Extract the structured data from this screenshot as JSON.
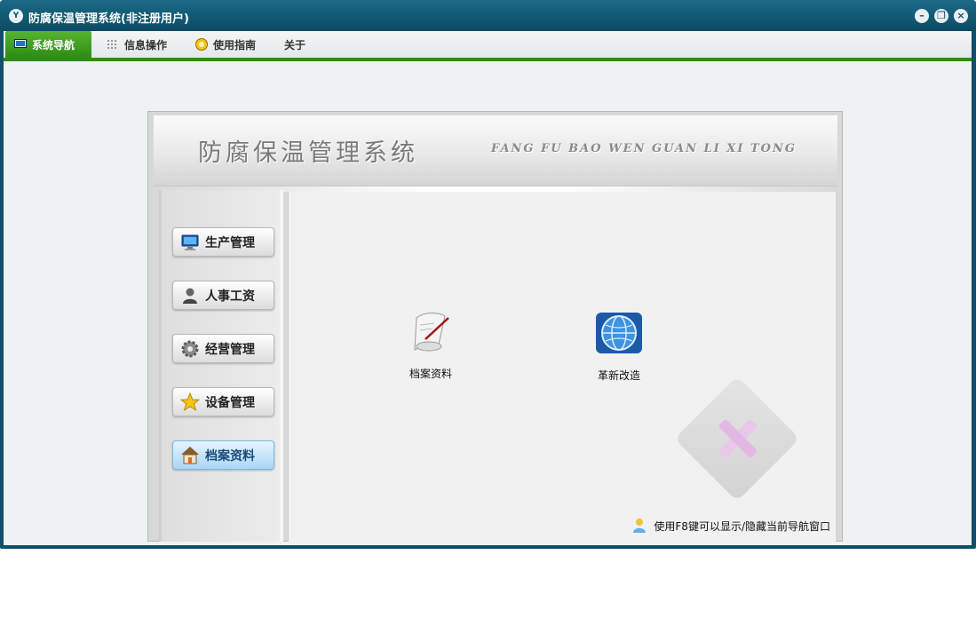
{
  "window": {
    "title": "防腐保温管理系统(非注册用户)",
    "app_icon_text": "Y"
  },
  "menubar": {
    "items": [
      {
        "label": "系统导航",
        "icon": "monitor-icon",
        "active": true
      },
      {
        "label": "信息操作",
        "icon": "grid-icon",
        "active": false
      },
      {
        "label": "使用指南",
        "icon": "help-icon",
        "active": false
      },
      {
        "label": "关于",
        "icon": "",
        "active": false
      }
    ]
  },
  "banner": {
    "title": "防腐保温管理系统",
    "subtitle": "FANG FU BAO  WEN  GUAN  LI  XI  TONG"
  },
  "sidebar": {
    "items": [
      {
        "label": "生产管理",
        "icon": "computer-icon",
        "active": false
      },
      {
        "label": "人事工资",
        "icon": "person-icon",
        "active": false
      },
      {
        "label": "经营管理",
        "icon": "gear-icon",
        "active": false
      },
      {
        "label": "设备管理",
        "icon": "star-icon",
        "active": false
      },
      {
        "label": "档案资料",
        "icon": "house-icon",
        "active": true
      }
    ]
  },
  "main": {
    "shortcuts": [
      {
        "label": "档案资料",
        "icon": "scroll-icon"
      },
      {
        "label": "革新改造",
        "icon": "globe-icon"
      }
    ],
    "hint": "使用F8键可以显示/隐藏当前导航窗口"
  },
  "colors": {
    "titlebar": "#0f4f68",
    "menu_accent": "#2e8b17",
    "active_nav": "#a9d6f5"
  }
}
